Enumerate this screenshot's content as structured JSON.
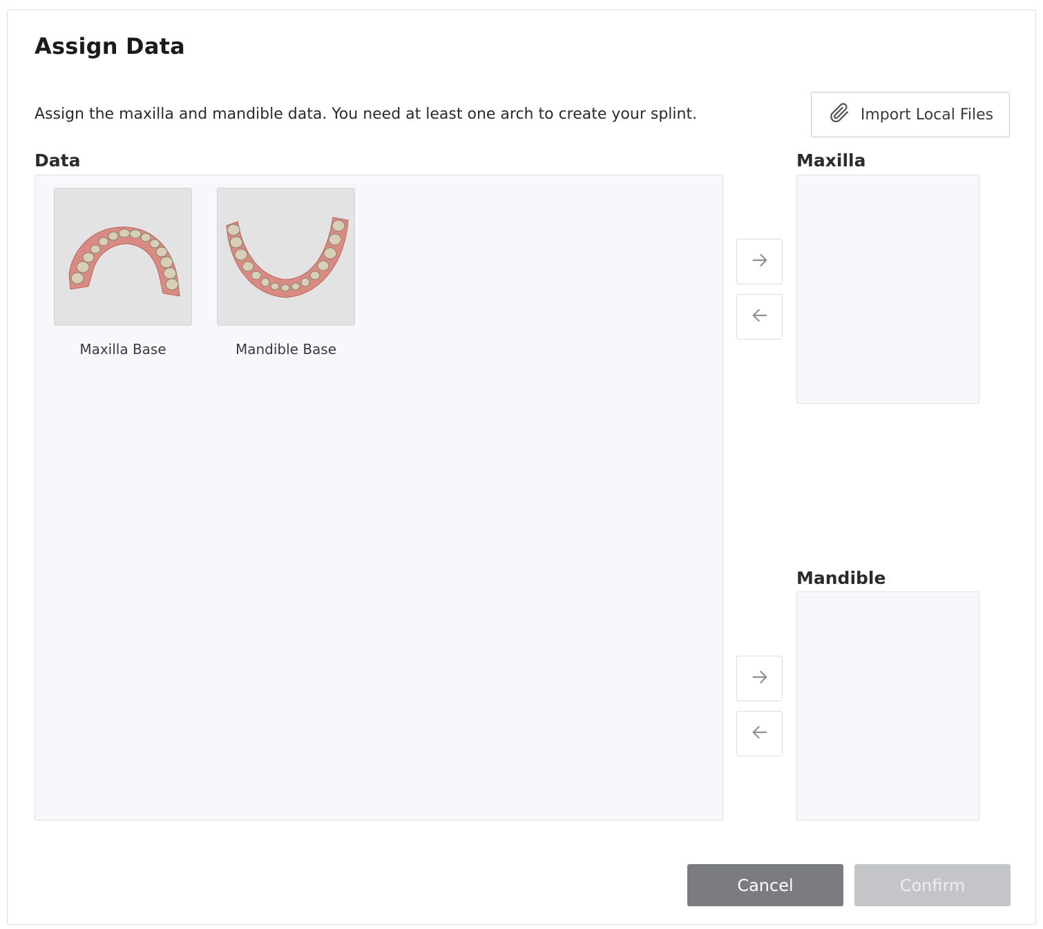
{
  "dialog": {
    "title": "Assign Data",
    "description": "Assign the maxilla and mandible data. You need at least one arch to create your splint.",
    "import_button": {
      "label": "Import Local Files",
      "icon": "paperclip-icon"
    }
  },
  "data_section": {
    "label": "Data",
    "items": [
      {
        "label": "Maxilla Base",
        "icon": "maxilla-scan-thumbnail"
      },
      {
        "label": "Mandible Base",
        "icon": "mandible-scan-thumbnail"
      }
    ]
  },
  "maxilla_section": {
    "label": "Maxilla",
    "assign_icon": "arrow-right-icon",
    "unassign_icon": "arrow-left-icon"
  },
  "mandible_section": {
    "label": "Mandible",
    "assign_icon": "arrow-right-icon",
    "unassign_icon": "arrow-left-icon"
  },
  "footer": {
    "cancel_label": "Cancel",
    "confirm_label": "Confirm"
  },
  "colors": {
    "panel_bg": "#f7f8fb",
    "cancel_bg": "#7b7c80",
    "confirm_disabled_bg": "#c4c5c8",
    "gum": "#d98a82",
    "tooth": "#d8cfb8"
  }
}
